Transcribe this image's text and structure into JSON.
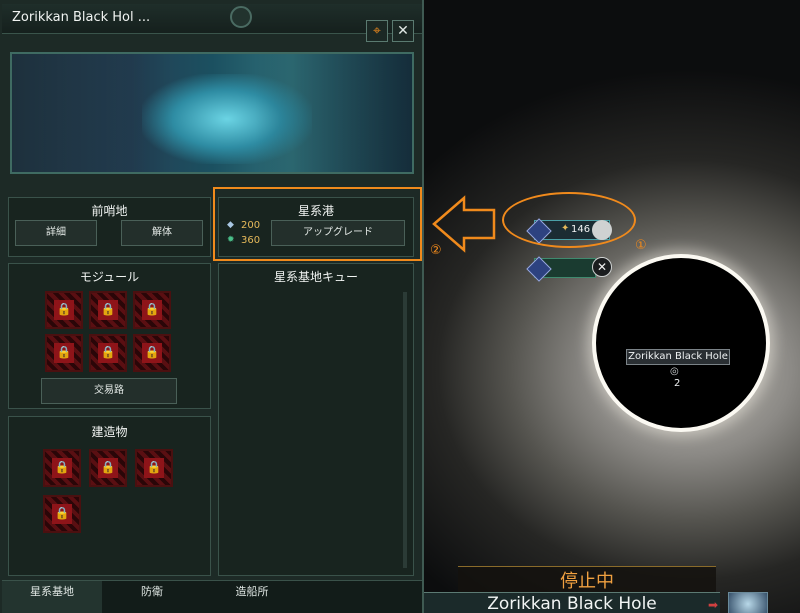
{
  "panel": {
    "title": "Zorikkan Black Hol ...",
    "close_glyph": "✕",
    "locate_glyph": "⌖"
  },
  "outpost": {
    "title": "前哨地",
    "details_label": "詳細",
    "dismantle_label": "解体"
  },
  "starport": {
    "title": "星系港",
    "cost_alloys": "200",
    "cost_energy": "360",
    "upgrade_label": "アップグレード"
  },
  "modules": {
    "title": "モジュール",
    "locked_count": 6,
    "trade_route_label": "交易路"
  },
  "buildings": {
    "title": "建造物",
    "locked_count": 4
  },
  "queue": {
    "title": "星系基地キュー"
  },
  "tabs": [
    {
      "label": "星系基地",
      "active": true
    },
    {
      "label": "防衛",
      "active": false
    },
    {
      "label": "造船所",
      "active": false
    }
  ],
  "map": {
    "fleet_power": "146",
    "black_hole_name": "Zorikkan Black Hole",
    "black_hole_count": "2",
    "paused_label": "停止中",
    "system_name": "Zorikkan Black Hole"
  },
  "annotations": {
    "marker_1": "①",
    "marker_2": "②"
  },
  "colors": {
    "callout": "#f08a1c",
    "panel_bg": "#1d2a26",
    "locked_red": "#8e1419"
  }
}
